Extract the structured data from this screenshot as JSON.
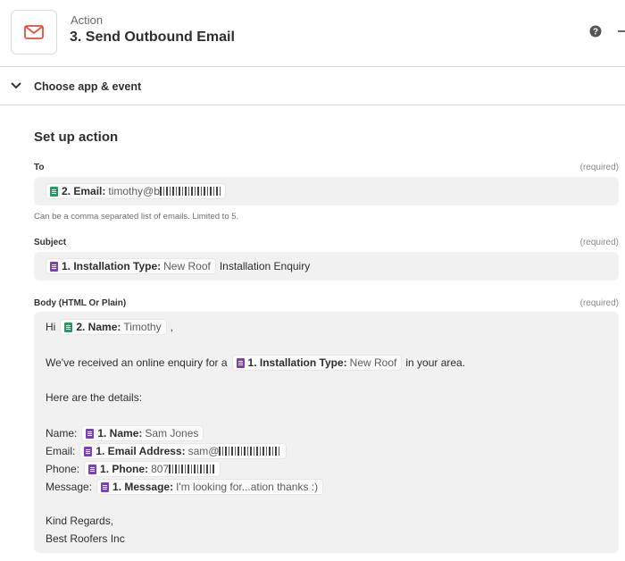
{
  "header": {
    "kicker": "Action",
    "title": "3. Send Outbound Email",
    "icons": [
      "email-icon",
      "help-icon",
      "more-icon"
    ]
  },
  "accordion": {
    "label": "Choose app & event"
  },
  "setup": {
    "title": "Set up action",
    "to": {
      "label": "To",
      "required": "(required)",
      "pill_key": "2. Email:",
      "pill_value": "timothy@b",
      "help": "Can be a comma separated list of emails. Limited to 5."
    },
    "subject": {
      "label": "Subject",
      "required": "(required)",
      "pill_key": "1. Installation Type:",
      "pill_value": "New Roof",
      "after": "Installation Enquiry"
    },
    "body": {
      "label": "Body (HTML Or Plain)",
      "required": "(required)",
      "greeting_prefix": "Hi",
      "greeting_pill_key": "2. Name:",
      "greeting_pill_value": "Timothy",
      "greeting_suffix": ",",
      "enquiry_prefix": "We've received an online enquiry for a",
      "enquiry_pill_key": "1. Installation Type:",
      "enquiry_pill_value": "New Roof",
      "enquiry_suffix": "in your area.",
      "details_heading": "Here are the details:",
      "name_label": "Name:",
      "name_pill_key": "1. Name:",
      "name_pill_value": "Sam Jones",
      "email_label": "Email:",
      "email_pill_key": "1. Email Address:",
      "email_pill_value": "sam@",
      "phone_label": "Phone:",
      "phone_pill_key": "1. Phone:",
      "phone_pill_value": "807",
      "message_label": "Message:",
      "message_pill_key": "1. Message:",
      "message_pill_value": "I'm looking for...ation thanks :)",
      "signoff": "Kind Regards,",
      "signature": "Best Roofers Inc"
    }
  },
  "colors": {
    "email_icon": "#e0513a",
    "sheets_green": "#1e9f58",
    "forms_purple": "#7b3fb8",
    "field_bg": "#f1f1f1"
  }
}
